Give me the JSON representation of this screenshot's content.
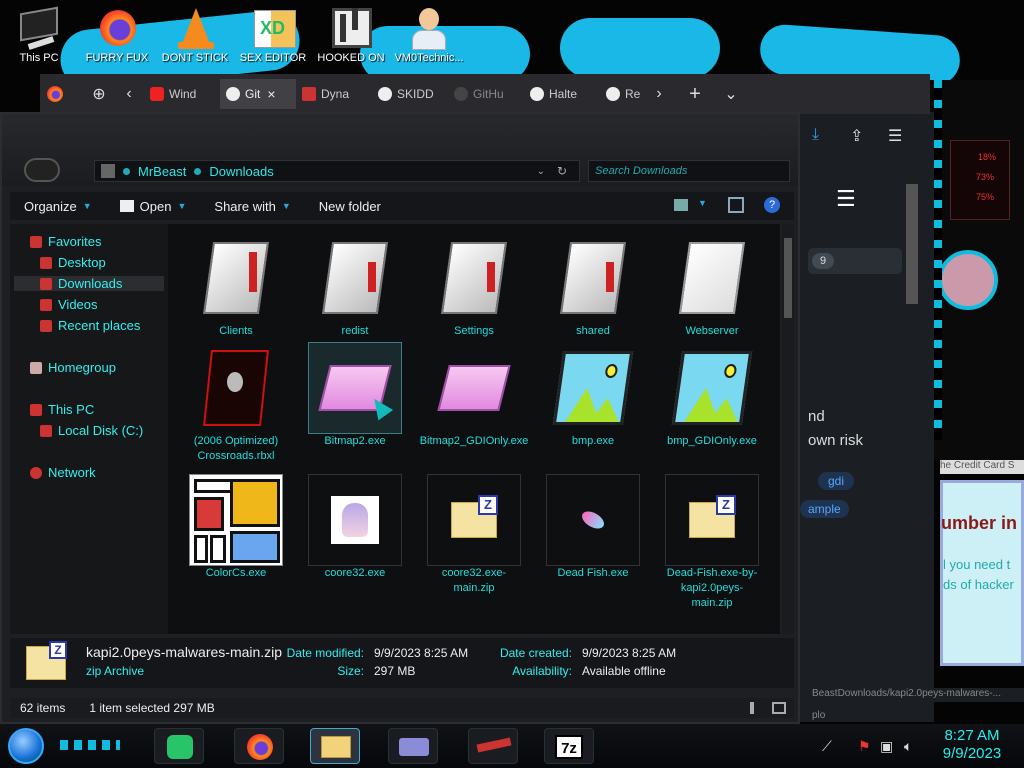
{
  "desktop_icons": [
    {
      "label": "This PC",
      "icon": "this-pc-icon"
    },
    {
      "label": "FURRY FUX",
      "icon": "firefox-shortcut-icon"
    },
    {
      "label": "DONT STICK",
      "icon": "vlc-cone-icon"
    },
    {
      "label": "SEX EDITOR",
      "icon": "hxd-editor-icon"
    },
    {
      "label": "HOOKED ON",
      "icon": "maze-app-icon"
    },
    {
      "label": "VM0Technic...",
      "icon": "doctor-avatar-icon"
    }
  ],
  "browser": {
    "tabs": [
      {
        "label": "Wind",
        "icon": "youtube-icon"
      },
      {
        "label": "Git",
        "icon": "github-icon",
        "active": true
      },
      {
        "label": "Dyna",
        "icon": "m-letter-icon"
      },
      {
        "label": "SKIDD",
        "icon": "github-icon"
      },
      {
        "label": "GitHu",
        "icon": "github-icon"
      },
      {
        "label": "Halte",
        "icon": "github-icon"
      },
      {
        "label": "Re",
        "icon": "github-icon"
      }
    ],
    "close_glyph": "×",
    "new_tab_glyph": "+",
    "list_glyph": "⌄",
    "back_glyph": "‹",
    "forward_glyph": "›"
  },
  "bg_browser": {
    "badge_count": "9",
    "text_line1": "nd",
    "text_line2": "own risk",
    "tag1": "gdi",
    "tag2": "ample",
    "page_heading": "umber in",
    "page_text1": "l you need t",
    "page_text2": "ds of hacker",
    "strip_text": "he Credit Card S",
    "path_text": "BeastDownloads/kapi2.0peys-malwares-...",
    "bottom_text": "plo"
  },
  "deco_percent": [
    "18%",
    "73%",
    "75%"
  ],
  "explorer": {
    "breadcrumb": [
      "MrBeast",
      "Downloads"
    ],
    "search_placeholder": "Search Downloads",
    "toolbar": {
      "organize": "Organize",
      "open": "Open",
      "share_with": "Share with",
      "new_folder": "New folder"
    },
    "nav": {
      "favorites": "Favorites",
      "desktop": "Desktop",
      "downloads": "Downloads",
      "videos": "Videos",
      "recent_places": "Recent places",
      "homegroup": "Homegroup",
      "this_pc": "This PC",
      "local_disk": "Local Disk (C:)",
      "network": "Network"
    },
    "files": [
      {
        "name": "Clients",
        "kind": "folder"
      },
      {
        "name": "redist",
        "kind": "folder"
      },
      {
        "name": "Settings",
        "kind": "folder"
      },
      {
        "name": "shared",
        "kind": "folder"
      },
      {
        "name": "Webserver",
        "kind": "folder"
      },
      {
        "name": "(2006 Optimized) Crossroads.rbxl",
        "kind": "alien"
      },
      {
        "name": "Bitmap2.exe",
        "kind": "eraser",
        "selected": true
      },
      {
        "name": "Bitmap2_GDIOnly.exe",
        "kind": "eraser"
      },
      {
        "name": "bmp.exe",
        "kind": "image"
      },
      {
        "name": "bmp_GDIOnly.exe",
        "kind": "image"
      },
      {
        "name": "ColorCs.exe",
        "kind": "colors"
      },
      {
        "name": "coore32.exe",
        "kind": "anime"
      },
      {
        "name": "coore32.exe-main.zip",
        "kind": "zip"
      },
      {
        "name": "Dead Fish.exe",
        "kind": "fish"
      },
      {
        "name": "Dead-Fish.exe-by-kapi2.0peys-main.zip",
        "kind": "zip"
      }
    ],
    "details": {
      "file_name": "kapi2.0peys-malwares-main.zip",
      "file_type": "zip Archive",
      "date_modified_label": "Date modified:",
      "date_modified": "9/9/2023 8:25 AM",
      "size_label": "Size:",
      "size": "297 MB",
      "date_created_label": "Date created:",
      "date_created": "9/9/2023 8:25 AM",
      "availability_label": "Availability:",
      "availability": "Available offline"
    },
    "status": {
      "item_count": "62 items",
      "selection": "1 item selected  297 MB"
    }
  },
  "taskbar": {
    "apps": [
      {
        "name": "chat-app",
        "icon": "green-chat-icon"
      },
      {
        "name": "firefox",
        "icon": "firefox-icon"
      },
      {
        "name": "explorer",
        "icon": "folder-icon",
        "active": true
      },
      {
        "name": "id-card-app",
        "icon": "id-card-icon"
      },
      {
        "name": "gun-app",
        "icon": "weapon-icon"
      },
      {
        "name": "7zip",
        "icon": "7zip-icon"
      }
    ],
    "sevenzip_label": "7z",
    "time": "8:27 AM",
    "date": "9/9/2023"
  }
}
